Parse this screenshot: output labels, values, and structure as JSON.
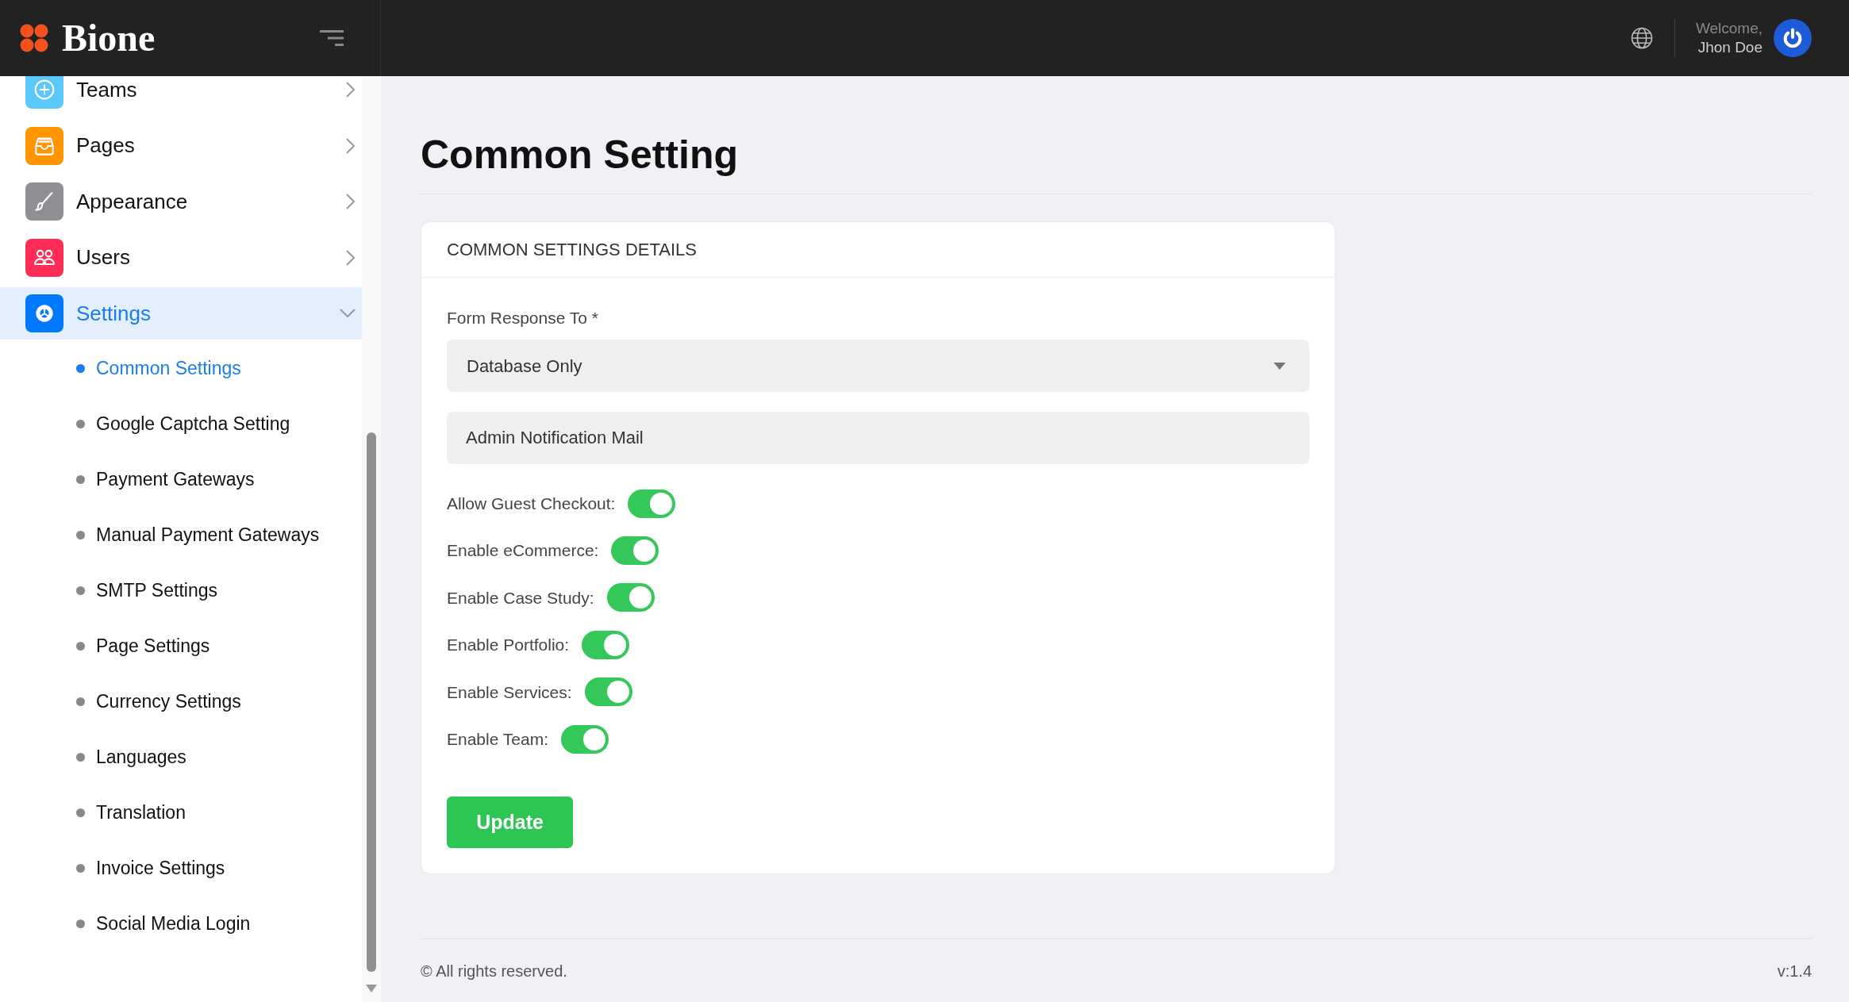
{
  "header": {
    "brand": "Bione",
    "welcome": "Welcome,",
    "user_name": "Jhon Doe"
  },
  "sidebar": {
    "items": [
      {
        "label": "Teams",
        "color": "#5ac8fa",
        "selected": false,
        "expanded": false
      },
      {
        "label": "Pages",
        "color": "#ff9500",
        "selected": false,
        "expanded": false
      },
      {
        "label": "Appearance",
        "color": "#8e8e93",
        "selected": false,
        "expanded": false
      },
      {
        "label": "Users",
        "color": "#ff2d55",
        "selected": false,
        "expanded": false
      },
      {
        "label": "Settings",
        "color": "#007aff",
        "selected": true,
        "expanded": true,
        "children": [
          {
            "label": "Common Settings",
            "selected": true
          },
          {
            "label": "Google Captcha Setting",
            "selected": false
          },
          {
            "label": "Payment Gateways",
            "selected": false
          },
          {
            "label": "Manual Payment Gateways",
            "selected": false
          },
          {
            "label": "SMTP Settings",
            "selected": false
          },
          {
            "label": "Page Settings",
            "selected": false
          },
          {
            "label": "Currency Settings",
            "selected": false
          },
          {
            "label": "Languages",
            "selected": false
          },
          {
            "label": "Translation",
            "selected": false
          },
          {
            "label": "Invoice Settings",
            "selected": false
          },
          {
            "label": "Social Media Login",
            "selected": false
          }
        ]
      }
    ]
  },
  "page": {
    "title": "Common Setting"
  },
  "card": {
    "title": "COMMON SETTINGS DETAILS",
    "form_response": {
      "label": "Form Response To *",
      "value": "Database Only"
    },
    "admin_mail": {
      "placeholder": "Admin Notification Mail"
    },
    "toggles": [
      {
        "label": "Allow Guest Checkout:",
        "on": true
      },
      {
        "label": "Enable eCommerce:",
        "on": true
      },
      {
        "label": "Enable Case Study:",
        "on": true
      },
      {
        "label": "Enable Portfolio:",
        "on": true
      },
      {
        "label": "Enable Services:",
        "on": true
      },
      {
        "label": "Enable Team:",
        "on": true
      }
    ],
    "submit": "Update"
  },
  "footer": {
    "copyright": "© All rights reserved.",
    "version": "v:1.4"
  }
}
